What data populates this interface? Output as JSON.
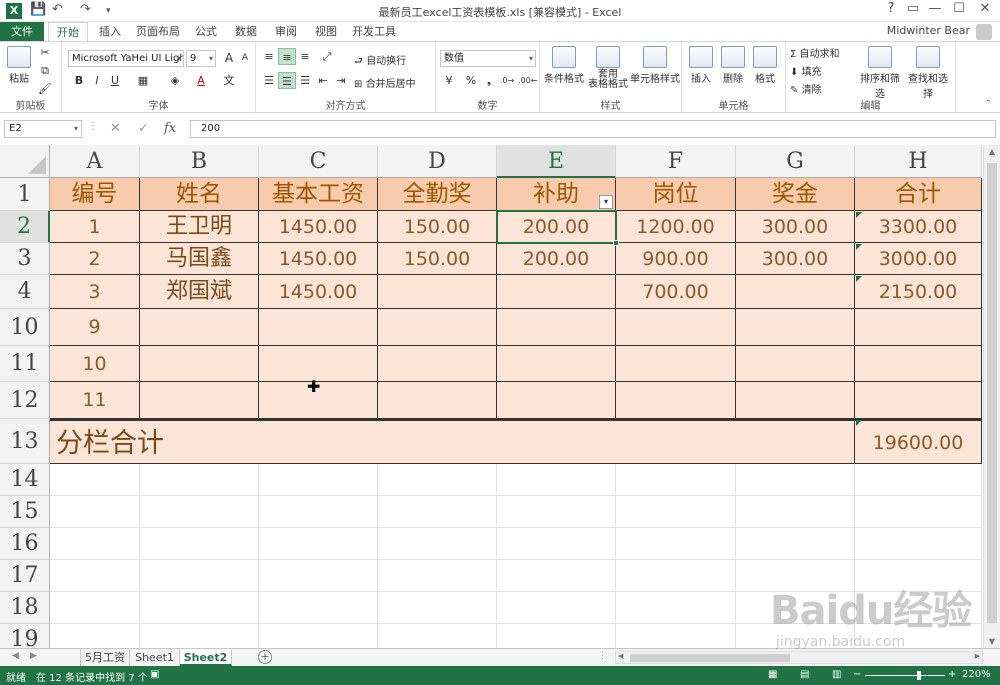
{
  "window": {
    "title": "最新员工excel工资表模板.xls  [兼容模式] - Excel",
    "controls": [
      "?",
      "▭",
      "—",
      "☐",
      "✕"
    ]
  },
  "tabs": {
    "file": "文件",
    "items": [
      "开始",
      "插入",
      "页面布局",
      "公式",
      "数据",
      "审阅",
      "视图",
      "开发工具"
    ],
    "active": "开始",
    "user": "Midwinter Bear"
  },
  "ribbon": {
    "clipboard": {
      "paste": "粘贴",
      "label": "剪贴板"
    },
    "font": {
      "name": "Microsoft YaHei UI Ligh",
      "size": "9",
      "bold": "B",
      "italic": "I",
      "underline": "U",
      "grow": "A",
      "shrink": "A",
      "label": "字体"
    },
    "alignment": {
      "wrap": "自动换行",
      "merge": "合并后居中",
      "label": "对齐方式"
    },
    "number": {
      "format": "数值",
      "percent": "%",
      "comma": "❟",
      "label": "数字"
    },
    "styles": {
      "conditional": "条件格式",
      "table": "套用",
      "table2": "表格格式",
      "cell": "单元格样式",
      "label": "样式"
    },
    "cells": {
      "insert": "插入",
      "delete": "删除",
      "format": "格式",
      "label": "单元格"
    },
    "editing": {
      "autosum": "自动求和",
      "fill": "填充",
      "clear": "清除",
      "sort": "排序和筛选",
      "find": "查找和选择",
      "label": "编辑"
    }
  },
  "formula_bar": {
    "name_box": "E2",
    "formula": "200"
  },
  "grid": {
    "columns": [
      "A",
      "B",
      "C",
      "D",
      "E",
      "F",
      "G",
      "H"
    ],
    "selected_column": "E",
    "rows": [
      "1",
      "2",
      "3",
      "4",
      "10",
      "11",
      "12",
      "13",
      "14",
      "15",
      "16",
      "17",
      "18",
      "19"
    ],
    "selected_row": "2",
    "header_row": [
      "编号",
      "姓名",
      "基本工资",
      "全勤奖",
      "补助",
      "岗位",
      "奖金",
      "合计"
    ],
    "data_rows": [
      [
        "1",
        "王卫明",
        "1450.00",
        "150.00",
        "200.00",
        "1200.00",
        "300.00",
        "3300.00"
      ],
      [
        "2",
        "马国鑫",
        "1450.00",
        "150.00",
        "200.00",
        "900.00",
        "300.00",
        "3000.00"
      ],
      [
        "3",
        "郑国斌",
        "1450.00",
        "",
        "",
        "700.00",
        "",
        "2150.00"
      ],
      [
        "9",
        "",
        "",
        "",
        "",
        "",
        "",
        ""
      ],
      [
        "10",
        "",
        "",
        "",
        "",
        "",
        "",
        ""
      ],
      [
        "11",
        "",
        "",
        "",
        "",
        "",
        "",
        ""
      ]
    ],
    "summary": {
      "label": "分栏合计",
      "total": "19600.00"
    },
    "filter_icon": "filter-dropdown-icon",
    "colors": {
      "header_fill": "#f8cbad",
      "data_fill": "#fce4d6",
      "accent": "#217346"
    }
  },
  "sheets": {
    "tabs": [
      "5月工资",
      "Sheet1",
      "Sheet2"
    ],
    "active": "Sheet2"
  },
  "status": {
    "ready": "就绪",
    "found": "在 12 条记录中找到 7 个",
    "zoom": "220%"
  },
  "watermark": {
    "brand": "Baidu经验",
    "url": "jingyan.baidu.com"
  }
}
